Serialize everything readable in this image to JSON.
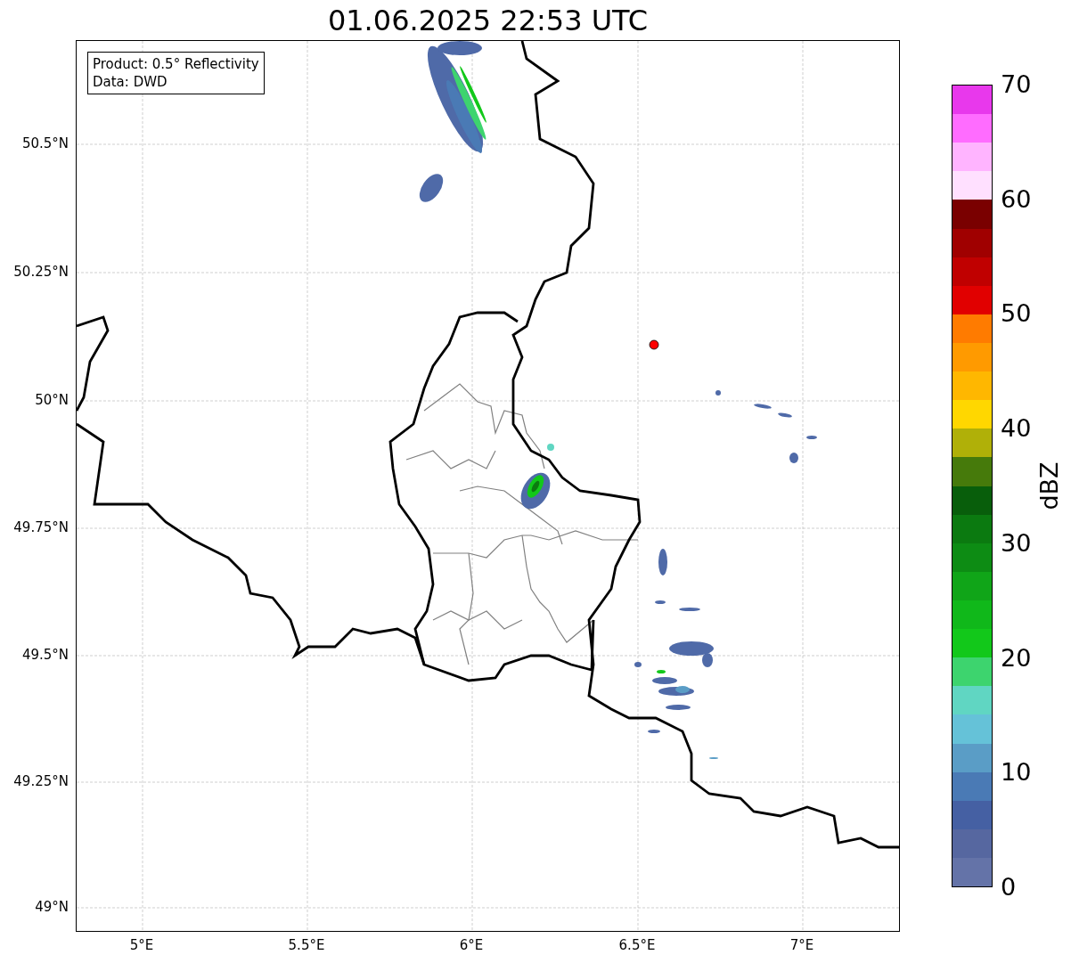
{
  "title": "01.06.2025 22:53 UTC",
  "legend": [
    "Product: 0.5° Reflectivity",
    "Data: DWD"
  ],
  "y_ticks": [
    "50.5°N",
    "50.25°N",
    "50°N",
    "49.75°N",
    "49.5°N",
    "49.25°N",
    "49°N"
  ],
  "x_ticks": [
    "5°E",
    "5.5°E",
    "6°E",
    "6.5°E",
    "7°E"
  ],
  "colorbar": {
    "label": "dBZ",
    "ticks": [
      "70",
      "60",
      "50",
      "40",
      "30",
      "20",
      "10",
      "0"
    ],
    "bands": [
      {
        "color": "#e838ec"
      },
      {
        "color": "#ff6cff"
      },
      {
        "color": "#ffb4ff"
      },
      {
        "color": "#ffe0ff"
      },
      {
        "color": "#7a0000"
      },
      {
        "color": "#a00000"
      },
      {
        "color": "#c00000"
      },
      {
        "color": "#e10000"
      },
      {
        "color": "#ff7b00"
      },
      {
        "color": "#ff9a00"
      },
      {
        "color": "#ffb700"
      },
      {
        "color": "#ffd700"
      },
      {
        "color": "#b0b008"
      },
      {
        "color": "#467a0b"
      },
      {
        "color": "#085e0b"
      },
      {
        "color": "#0b7a10"
      },
      {
        "color": "#0d8c14"
      },
      {
        "color": "#10a518"
      },
      {
        "color": "#10b81a"
      },
      {
        "color": "#12c81a"
      },
      {
        "color": "#3dd46e"
      },
      {
        "color": "#60d6c2"
      },
      {
        "color": "#65c2d8"
      },
      {
        "color": "#5a9dc6"
      },
      {
        "color": "#4a7ab5"
      },
      {
        "color": "#4560a3"
      },
      {
        "color": "#5667a0"
      },
      {
        "color": "#6473a8"
      }
    ]
  }
}
